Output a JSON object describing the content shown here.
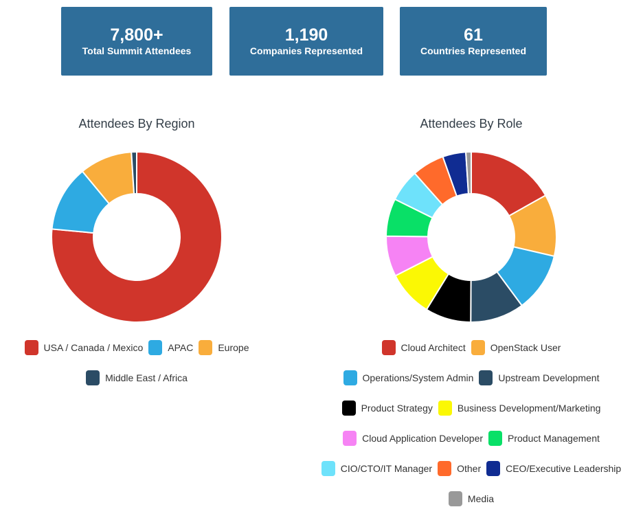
{
  "stats": [
    {
      "value": "7,800+",
      "label": "Total Summit Attendees"
    },
    {
      "value": "1,190",
      "label": "Companies Represented"
    },
    {
      "value": "61",
      "label": "Countries Represented"
    }
  ],
  "chart_data": [
    {
      "type": "pie",
      "title": "Attendees By Region",
      "donut": true,
      "legend_position": "bottom",
      "categories": [
        "USA / Canada / Mexico",
        "APAC",
        "Europe",
        "Middle East / Africa"
      ],
      "values": [
        76.5,
        12.5,
        10.0,
        1.0
      ],
      "colors": [
        "#d0352b",
        "#2eaae2",
        "#f9ad3c",
        "#2b4c65"
      ]
    },
    {
      "type": "pie",
      "title": "Attendees By Role",
      "donut": true,
      "legend_position": "bottom",
      "categories": [
        "Cloud Architect",
        "OpenStack User",
        "Operations/System Admin",
        "Upstream Development",
        "Product Strategy",
        "Business Development/Marketing",
        "Cloud Application Developer",
        "Product Management",
        "CIO/CTO/IT Manager",
        "Other",
        "CEO/Executive Leadership",
        "Media"
      ],
      "values": [
        16.5,
        11.5,
        11.0,
        10.0,
        8.5,
        8.5,
        7.5,
        7.0,
        6.0,
        6.0,
        4.3,
        1.0
      ],
      "colors": [
        "#d0352b",
        "#f9ad3c",
        "#2eaae2",
        "#2b4c65",
        "#000000",
        "#fbf804",
        "#f683f4",
        "#09e067",
        "#6ee2fb",
        "#ff6a2b",
        "#102c92",
        "#999999"
      ]
    }
  ]
}
